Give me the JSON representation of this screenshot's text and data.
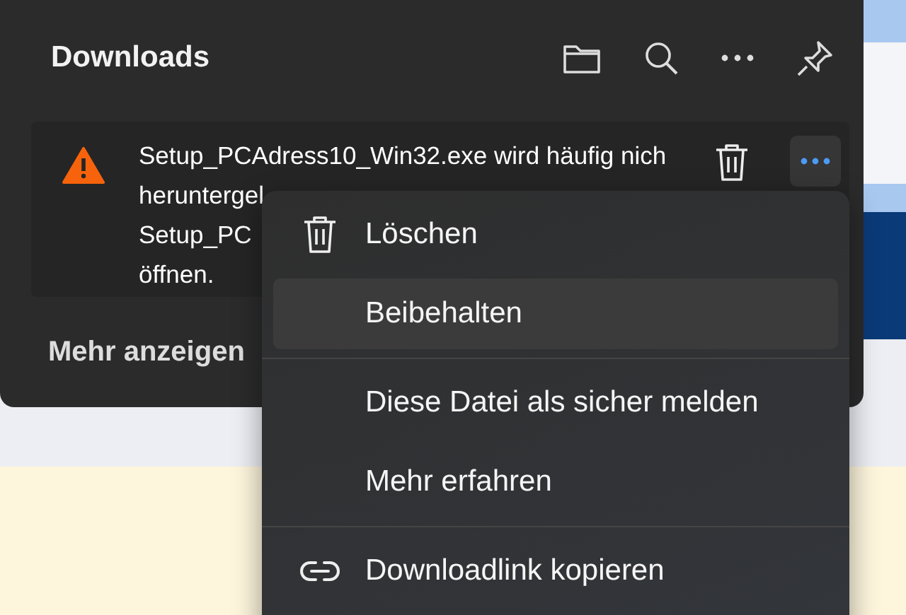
{
  "panel": {
    "title": "Downloads"
  },
  "download": {
    "lines": [
      "Setup_PCAdress10_Win32.exe wird häufig nich",
      "heruntergel",
      "Setup_PC",
      "öffnen."
    ],
    "more_open": true
  },
  "show_more": "Mehr anzeigen",
  "menu": [
    {
      "kind": "delete",
      "label": "Löschen",
      "highlighted": false
    },
    {
      "kind": "plain",
      "label": "Beibehalten",
      "highlighted": true
    },
    {
      "kind": "separator"
    },
    {
      "kind": "plain",
      "label": "Diese Datei als sicher melden",
      "highlighted": false
    },
    {
      "kind": "plain",
      "label": "Mehr erfahren",
      "highlighted": false
    },
    {
      "kind": "separator"
    },
    {
      "kind": "copy-link",
      "label": "Downloadlink kopieren",
      "highlighted": false
    }
  ]
}
